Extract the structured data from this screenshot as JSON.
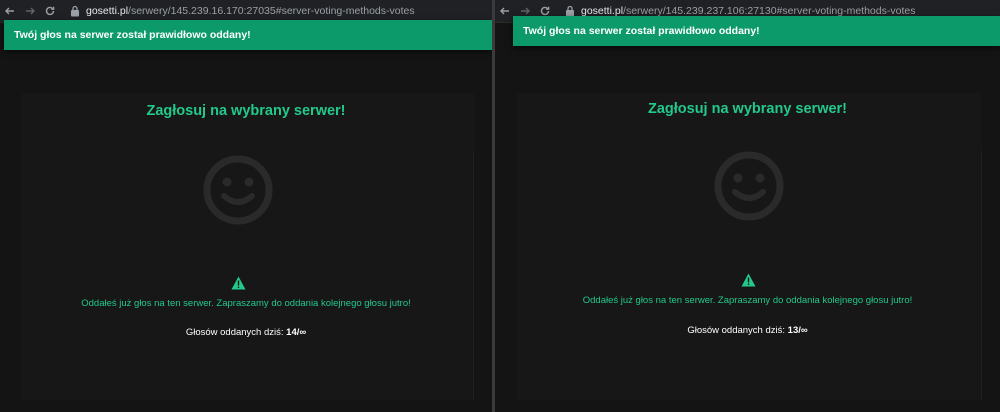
{
  "left": {
    "browser": {
      "url_host": "gosetti.pl",
      "url_path": "/serwery/145.239.16.170:27035#server-voting-methods-votes"
    },
    "alert": {
      "text": "Twój głos na serwer został prawidłowo oddany!"
    },
    "heading": "Zagłosuj na wybrany serwer!",
    "message": "Oddałeś już głos na ten serwer. Zapraszamy do oddania kolejnego głosu jutro!",
    "votes_label": "Głosów oddanych dziś:",
    "votes_value": "14/∞"
  },
  "right": {
    "browser": {
      "url_host": "gosetti.pl",
      "url_path": "/serwery/145.239.237.106:27130#server-voting-methods-votes"
    },
    "alert": {
      "text": "Twój głos na serwer został prawidłowo oddany!"
    },
    "heading": "Zagłosuj na wybrany serwer!",
    "message": "Oddałeś już głos na ten serwer. Zapraszamy do oddania kolejnego głosu jutro!",
    "votes_label": "Głosów oddanych dziś:",
    "votes_value": "13/∞"
  },
  "icons": {
    "back": "arrow-left-icon",
    "forward": "arrow-right-icon",
    "reload": "reload-icon",
    "lock": "lock-icon",
    "face": "smiley-icon",
    "warning": "warning-triangle-icon"
  },
  "colors": {
    "accent": "#22c98b",
    "alert_bg": "#0d9a6b",
    "page_bg": "#141414",
    "toolbar_bg": "#202124"
  }
}
